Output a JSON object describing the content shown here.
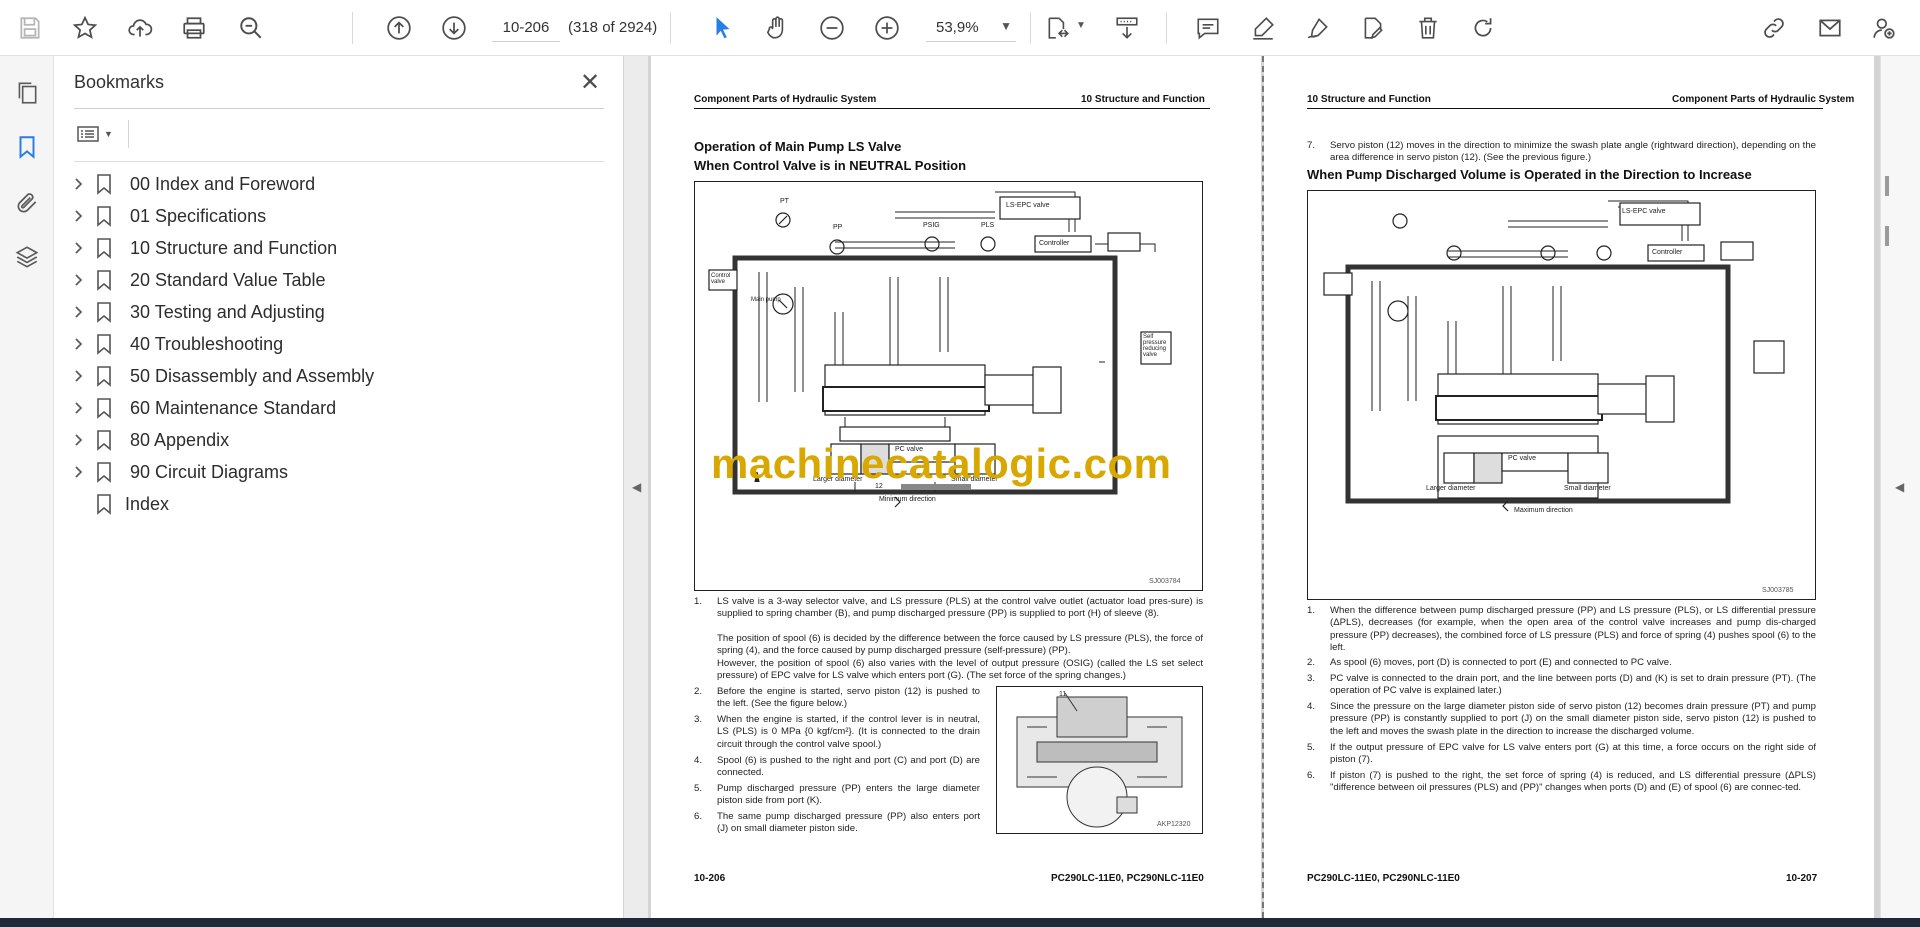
{
  "toolbar": {
    "page_value": "10-206",
    "page_count": "(318 of 2924)",
    "zoom": "53,9%"
  },
  "bookmarks": {
    "title": "Bookmarks",
    "items": [
      {
        "label": "00 Index and Foreword",
        "expandable": true
      },
      {
        "label": "01 Specifications",
        "expandable": true
      },
      {
        "label": "10 Structure and Function",
        "expandable": true
      },
      {
        "label": "20 Standard Value Table",
        "expandable": true
      },
      {
        "label": "30 Testing and Adjusting",
        "expandable": true
      },
      {
        "label": "40 Troubleshooting",
        "expandable": true
      },
      {
        "label": "50 Disassembly and Assembly",
        "expandable": true
      },
      {
        "label": "60 Maintenance Standard",
        "expandable": true
      },
      {
        "label": "80 Appendix",
        "expandable": true
      },
      {
        "label": "90 Circuit Diagrams",
        "expandable": true
      },
      {
        "label": "Index",
        "expandable": false
      }
    ]
  },
  "left_page": {
    "header_left": "Component Parts of Hydraulic System",
    "header_right": "10 Structure and Function",
    "title_line1": "Operation of Main Pump LS Valve",
    "title_line2": "When Control Valve is in NEUTRAL Position",
    "figure_code": "SJ003784",
    "figure_labels": {
      "pt": "PT",
      "pp": "PP",
      "psig": "PSIG",
      "pls": "PLS",
      "ls_epc": "LS-EPC valve",
      "controller": "Controller",
      "control_valve": "Control valve",
      "main_pump": "Main pump",
      "self_pressure": "Self pressure reducing valve",
      "pc_valve": "PC valve",
      "larger": "Larger diameter",
      "small": "Small diameter",
      "minimum": "Minimum direction",
      "num_12": "12"
    },
    "items": [
      {
        "num": "1.",
        "text": "LS valve is a 3-way selector valve, and LS pressure (PLS) at the control valve outlet (actuator load pres-sure) is supplied to spring chamber (B), and pump discharged pressure (PP) is supplied to port (H) of sleeve (8).",
        "extra1": "The position of spool (6) is decided by the difference between the force caused by LS pressure (PLS), the force of spring (4), and the force caused by pump discharged pressure (self-pressure) (PP).",
        "extra2": "However, the position of spool (6) also varies with the level of output pressure (OSIG) (called the LS set select pressure) of EPC valve for LS valve which enters port (G). (The set force of the spring changes.)"
      },
      {
        "num": "2.",
        "text": "Before the engine is started, servo piston (12) is pushed to the left. (See the figure below.)"
      },
      {
        "num": "3.",
        "text": "When the engine is started, if the control lever is in neutral, LS (PLS) is 0 MPa {0 kgf/cm²}. (It is connected to the drain circuit through the control valve spool.)"
      },
      {
        "num": "4.",
        "text": "Spool (6) is pushed to the right and port (C) and port (D) are connected."
      },
      {
        "num": "5.",
        "text": "Pump discharged pressure (PP) enters the large diameter piston side from port (K)."
      },
      {
        "num": "6.",
        "text": "The same pump discharged pressure (PP) also enters port (J) on small diameter piston side."
      }
    ],
    "photo_code": "AKP12320",
    "photo_label": "11",
    "footer_left": "10-206",
    "footer_right": "PC290LC-11E0, PC290NLC-11E0"
  },
  "right_page": {
    "header_left": "10 Structure and Function",
    "header_right": "Component Parts of Hydraulic System",
    "intro_num": "7.",
    "intro_text": "Servo piston (12) moves in the direction to minimize the swash plate angle (rightward direction), depending on the area difference in servo piston (12). (See the previous figure.)",
    "title": "When Pump Discharged Volume is Operated in the Direction to Increase",
    "figure_code": "SJ003785",
    "figure_labels": {
      "maximum": "Maximum direction",
      "larger": "Larger diameter",
      "small": "Small diameter",
      "pc_valve": "PC valve",
      "ls_epc": "LS-EPC valve",
      "controller": "Controller"
    },
    "items": [
      {
        "num": "1.",
        "text": "When the difference between pump discharged pressure (PP) and LS pressure (PLS), or LS differential pressure (ΔPLS), decreases (for example, when the open area of the control valve increases and pump dis-charged pressure (PP) decreases), the combined force of LS pressure (PLS) and force of spring (4) pushes spool (6) to the left."
      },
      {
        "num": "2.",
        "text": "As spool (6) moves, port (D) is connected to port (E) and connected to PC valve."
      },
      {
        "num": "3.",
        "text": "PC valve is connected to the drain port, and the line between ports (D) and (K) is set to drain pressure (PT). (The operation of PC valve is explained later.)"
      },
      {
        "num": "4.",
        "text": "Since the pressure on the large diameter piston side of servo piston (12) becomes drain pressure (PT) and pump pressure (PP) is constantly supplied to port (J) on the small diameter piston side, servo piston (12) is pushed to the left and moves the swash plate in the direction to increase the discharged volume."
      },
      {
        "num": "5.",
        "text": "If the output pressure of EPC valve for LS valve enters port (G) at this time, a force occurs on the right side of piston (7)."
      },
      {
        "num": "6.",
        "text": "If piston (7) is pushed to the right, the set force of spring (4) is reduced, and LS differential pressure (ΔPLS) \"difference between oil pressures (PLS) and (PP)\" changes when ports (D) and (E) of spool (6) are connec-ted."
      }
    ],
    "footer_left": "PC290LC-11E0, PC290NLC-11E0",
    "footer_right": "10-207"
  },
  "watermark": "machinecatalogic.com"
}
